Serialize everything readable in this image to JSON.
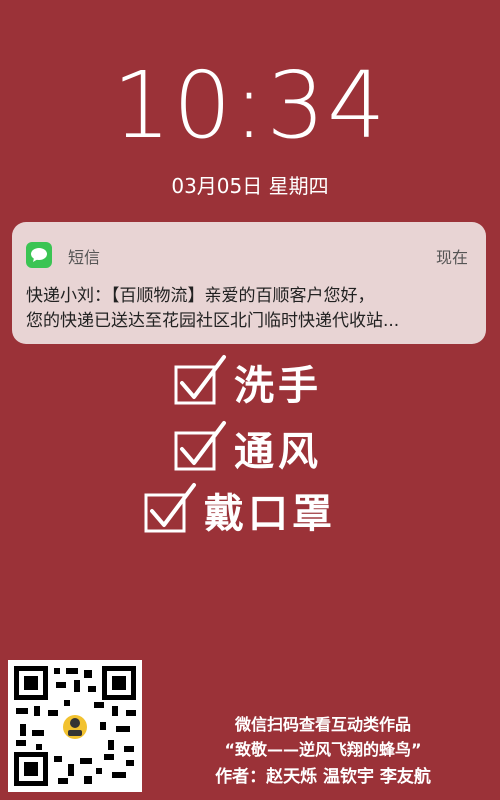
{
  "lockscreen": {
    "time": "10:34",
    "date": "03月05日 星期四"
  },
  "notification": {
    "app_name": "短信",
    "time": "现在",
    "line1": "快递小刘：【百顺物流】亲爱的百顺客户您好，",
    "line2": "您的快递已送达至花园社区北门临时快递代收站..."
  },
  "checklist": {
    "items": [
      {
        "label": "洗手"
      },
      {
        "label": "通风"
      },
      {
        "label": "戴口罩"
      }
    ]
  },
  "footer": {
    "line1": "微信扫码查看互动类作品",
    "line2": "“致敬——逆风飞翔的蜂鸟”",
    "line3": "作者：赵天烁 温钦宇 李友航"
  },
  "colors": {
    "background": "#9b3238",
    "notification_bg": "#e8d4d4",
    "messages_icon": "#3bc453"
  },
  "icons": {
    "messages": "messages-icon",
    "check": "checkbox-checked-icon",
    "qr": "qr-code-icon"
  }
}
